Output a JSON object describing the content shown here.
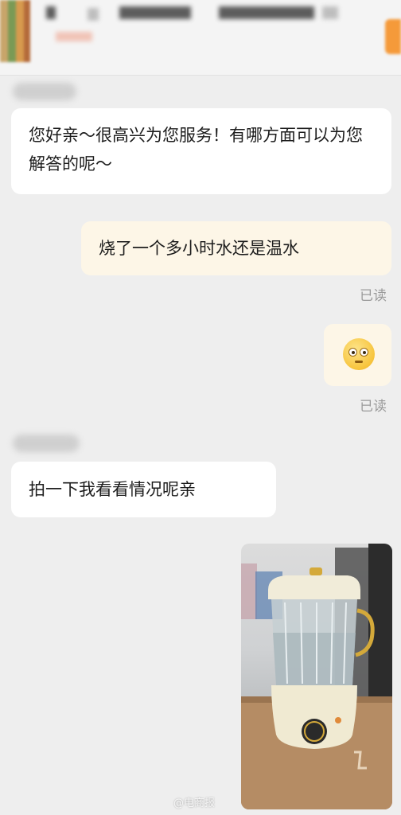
{
  "messages": [
    {
      "text": "您好亲～很高兴为您服务！有哪方面可以为您解答的呢～"
    },
    {
      "text": "烧了一个多小时水还是温水",
      "status": "已读"
    },
    {
      "emoji": "flushed-face-emoji",
      "status": "已读"
    },
    {
      "text": "拍一下我看看情况呢亲"
    },
    {
      "image": "photo-kettle"
    }
  ],
  "watermark": "@电商报"
}
